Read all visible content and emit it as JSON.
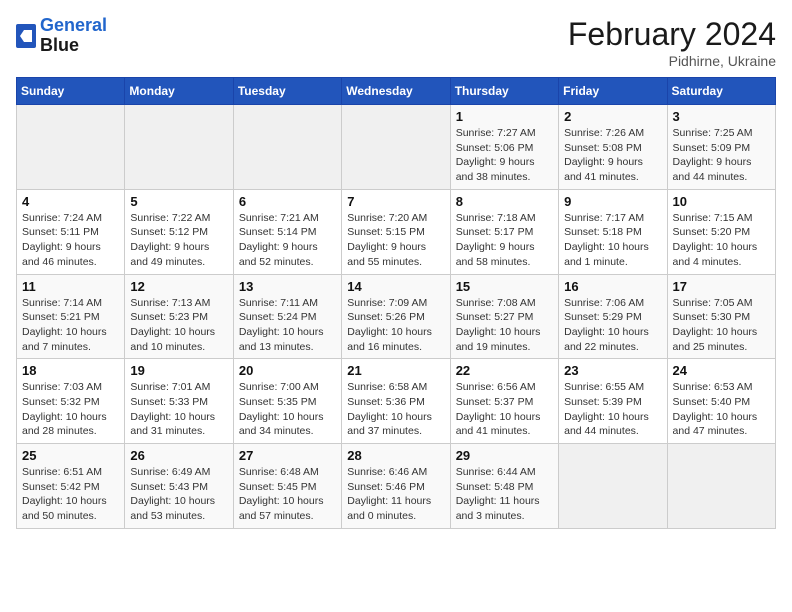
{
  "header": {
    "logo_line1": "General",
    "logo_line2": "Blue",
    "title": "February 2024",
    "subtitle": "Pidhirne, Ukraine"
  },
  "columns": [
    "Sunday",
    "Monday",
    "Tuesday",
    "Wednesday",
    "Thursday",
    "Friday",
    "Saturday"
  ],
  "weeks": [
    [
      {
        "day": "",
        "info": ""
      },
      {
        "day": "",
        "info": ""
      },
      {
        "day": "",
        "info": ""
      },
      {
        "day": "",
        "info": ""
      },
      {
        "day": "1",
        "info": "Sunrise: 7:27 AM\nSunset: 5:06 PM\nDaylight: 9 hours\nand 38 minutes."
      },
      {
        "day": "2",
        "info": "Sunrise: 7:26 AM\nSunset: 5:08 PM\nDaylight: 9 hours\nand 41 minutes."
      },
      {
        "day": "3",
        "info": "Sunrise: 7:25 AM\nSunset: 5:09 PM\nDaylight: 9 hours\nand 44 minutes."
      }
    ],
    [
      {
        "day": "4",
        "info": "Sunrise: 7:24 AM\nSunset: 5:11 PM\nDaylight: 9 hours\nand 46 minutes."
      },
      {
        "day": "5",
        "info": "Sunrise: 7:22 AM\nSunset: 5:12 PM\nDaylight: 9 hours\nand 49 minutes."
      },
      {
        "day": "6",
        "info": "Sunrise: 7:21 AM\nSunset: 5:14 PM\nDaylight: 9 hours\nand 52 minutes."
      },
      {
        "day": "7",
        "info": "Sunrise: 7:20 AM\nSunset: 5:15 PM\nDaylight: 9 hours\nand 55 minutes."
      },
      {
        "day": "8",
        "info": "Sunrise: 7:18 AM\nSunset: 5:17 PM\nDaylight: 9 hours\nand 58 minutes."
      },
      {
        "day": "9",
        "info": "Sunrise: 7:17 AM\nSunset: 5:18 PM\nDaylight: 10 hours\nand 1 minute."
      },
      {
        "day": "10",
        "info": "Sunrise: 7:15 AM\nSunset: 5:20 PM\nDaylight: 10 hours\nand 4 minutes."
      }
    ],
    [
      {
        "day": "11",
        "info": "Sunrise: 7:14 AM\nSunset: 5:21 PM\nDaylight: 10 hours\nand 7 minutes."
      },
      {
        "day": "12",
        "info": "Sunrise: 7:13 AM\nSunset: 5:23 PM\nDaylight: 10 hours\nand 10 minutes."
      },
      {
        "day": "13",
        "info": "Sunrise: 7:11 AM\nSunset: 5:24 PM\nDaylight: 10 hours\nand 13 minutes."
      },
      {
        "day": "14",
        "info": "Sunrise: 7:09 AM\nSunset: 5:26 PM\nDaylight: 10 hours\nand 16 minutes."
      },
      {
        "day": "15",
        "info": "Sunrise: 7:08 AM\nSunset: 5:27 PM\nDaylight: 10 hours\nand 19 minutes."
      },
      {
        "day": "16",
        "info": "Sunrise: 7:06 AM\nSunset: 5:29 PM\nDaylight: 10 hours\nand 22 minutes."
      },
      {
        "day": "17",
        "info": "Sunrise: 7:05 AM\nSunset: 5:30 PM\nDaylight: 10 hours\nand 25 minutes."
      }
    ],
    [
      {
        "day": "18",
        "info": "Sunrise: 7:03 AM\nSunset: 5:32 PM\nDaylight: 10 hours\nand 28 minutes."
      },
      {
        "day": "19",
        "info": "Sunrise: 7:01 AM\nSunset: 5:33 PM\nDaylight: 10 hours\nand 31 minutes."
      },
      {
        "day": "20",
        "info": "Sunrise: 7:00 AM\nSunset: 5:35 PM\nDaylight: 10 hours\nand 34 minutes."
      },
      {
        "day": "21",
        "info": "Sunrise: 6:58 AM\nSunset: 5:36 PM\nDaylight: 10 hours\nand 37 minutes."
      },
      {
        "day": "22",
        "info": "Sunrise: 6:56 AM\nSunset: 5:37 PM\nDaylight: 10 hours\nand 41 minutes."
      },
      {
        "day": "23",
        "info": "Sunrise: 6:55 AM\nSunset: 5:39 PM\nDaylight: 10 hours\nand 44 minutes."
      },
      {
        "day": "24",
        "info": "Sunrise: 6:53 AM\nSunset: 5:40 PM\nDaylight: 10 hours\nand 47 minutes."
      }
    ],
    [
      {
        "day": "25",
        "info": "Sunrise: 6:51 AM\nSunset: 5:42 PM\nDaylight: 10 hours\nand 50 minutes."
      },
      {
        "day": "26",
        "info": "Sunrise: 6:49 AM\nSunset: 5:43 PM\nDaylight: 10 hours\nand 53 minutes."
      },
      {
        "day": "27",
        "info": "Sunrise: 6:48 AM\nSunset: 5:45 PM\nDaylight: 10 hours\nand 57 minutes."
      },
      {
        "day": "28",
        "info": "Sunrise: 6:46 AM\nSunset: 5:46 PM\nDaylight: 11 hours\nand 0 minutes."
      },
      {
        "day": "29",
        "info": "Sunrise: 6:44 AM\nSunset: 5:48 PM\nDaylight: 11 hours\nand 3 minutes."
      },
      {
        "day": "",
        "info": ""
      },
      {
        "day": "",
        "info": ""
      }
    ]
  ]
}
